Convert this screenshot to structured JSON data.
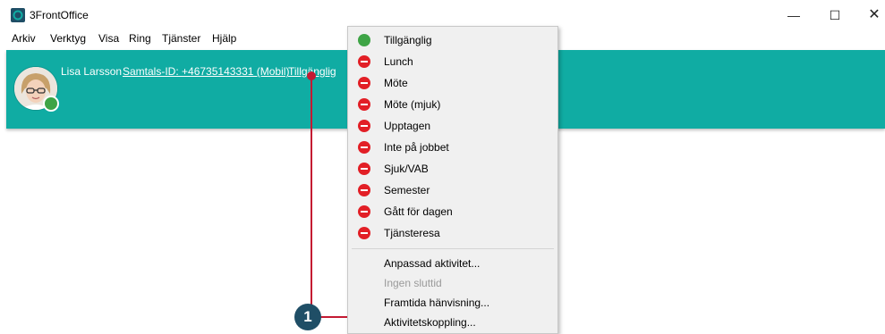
{
  "window": {
    "title": "3FrontOffice",
    "minimize": "—",
    "maximize": "☐",
    "close": "✕"
  },
  "menu": [
    "Arkiv",
    "Verktyg",
    "Visa",
    "Ring",
    "Tjänster",
    "Hjälp"
  ],
  "user": {
    "name": "Lisa Larsson",
    "call_id": "Samtals-ID: +46735143331 (Mobil)",
    "status": "Tillgänglig"
  },
  "dropdown": {
    "statuses": [
      {
        "label": "Tillgänglig",
        "icon": "green-dot-icon"
      },
      {
        "label": "Lunch",
        "icon": "red-minus-icon"
      },
      {
        "label": "Möte",
        "icon": "red-minus-icon"
      },
      {
        "label": "Möte (mjuk)",
        "icon": "red-minus-icon"
      },
      {
        "label": "Upptagen",
        "icon": "red-minus-icon"
      },
      {
        "label": "Inte på jobbet",
        "icon": "red-minus-icon"
      },
      {
        "label": "Sjuk/VAB",
        "icon": "red-minus-icon"
      },
      {
        "label": "Semester",
        "icon": "red-minus-icon"
      },
      {
        "label": "Gått för dagen",
        "icon": "red-minus-icon"
      },
      {
        "label": "Tjänsteresa",
        "icon": "red-minus-icon"
      }
    ],
    "actions": [
      {
        "label": "Anpassad aktivitet...",
        "enabled": true
      },
      {
        "label": "Ingen sluttid",
        "enabled": false
      },
      {
        "label": "Framtida hänvisning...",
        "enabled": true
      },
      {
        "label": "Aktivitetskoppling...",
        "enabled": true
      }
    ]
  },
  "callout": {
    "number": "1"
  },
  "colors": {
    "topbar": "#10aca3",
    "available": "#3ea446",
    "busy": "#e21f26",
    "callout": "#c41932",
    "badge": "#1f4e66"
  }
}
